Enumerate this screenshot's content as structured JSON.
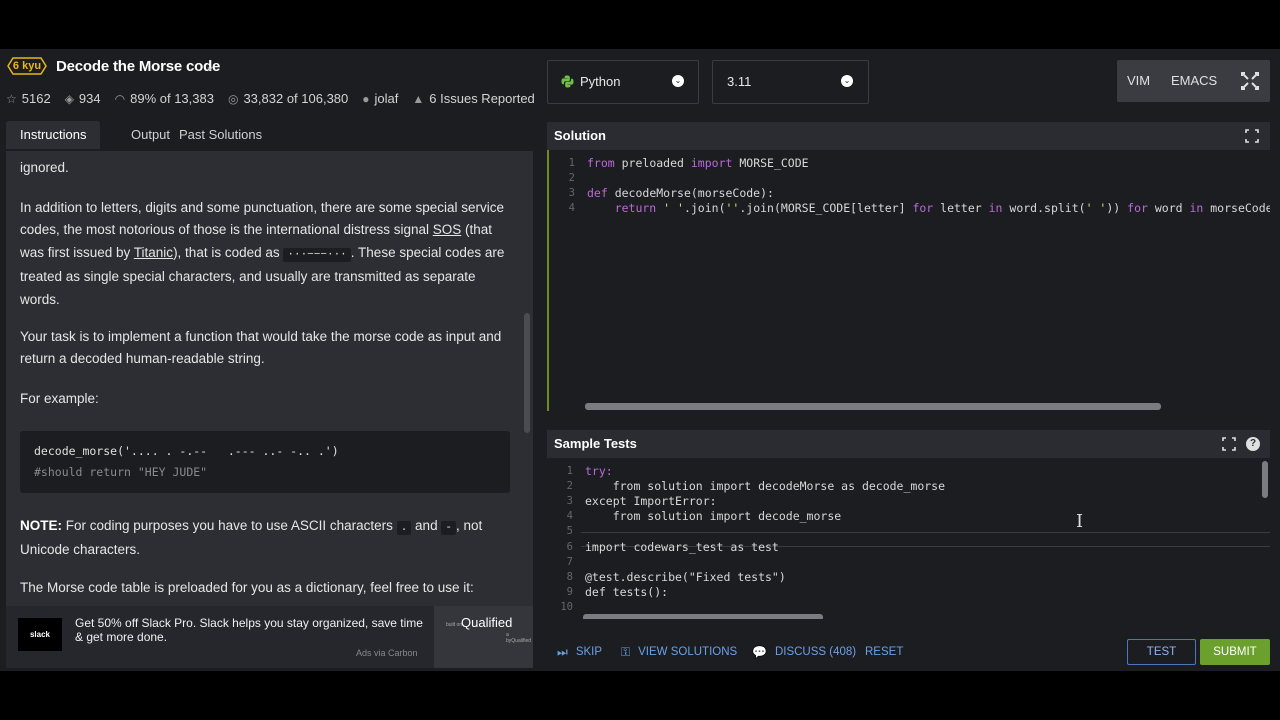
{
  "kata": {
    "rank": "6 kyu",
    "title": "Decode the Morse code",
    "title_chevron": "⌄",
    "stats": {
      "stars": "5162",
      "collections": "934",
      "satisfaction": "89% of 13,383",
      "completed": "33,832 of 106,380",
      "author": "jolaf",
      "issues": "6 Issues Reported"
    }
  },
  "left_tabs": [
    "Instructions",
    "Output",
    "Past Solutions"
  ],
  "instructions": {
    "p0": "ignored.",
    "p1_a": "In addition to letters, digits and some punctuation, there are some special service codes, the most notorious of those is the international distress signal ",
    "p1_link1": "SOS",
    "p1_b": " (that was first issued by ",
    "p1_link2": "Titanic",
    "p1_c": "), that is coded as ",
    "p1_code": "···−−−···",
    "p1_d": ". These special codes are treated as single special characters, and usually are transmitted as separate words.",
    "p2": "Your task is to implement a function that would take the morse code as input and return a decoded human-readable string.",
    "p3": "For example:",
    "code_line1": "decode_morse('.... . -.--   .--- ..- -.. .')",
    "code_line2": "#should return \"HEY JUDE\"",
    "p4_bold": "NOTE:",
    "p4_a": " For coding purposes you have to use ASCII characters ",
    "p4_code1": ".",
    "p4_b": " and ",
    "p4_code2": "-",
    "p4_c": ", not Unicode characters.",
    "p5": "The Morse code table is preloaded for you as a dictionary, feel free to use it:"
  },
  "ad": {
    "logo": "slack",
    "text": "Get 50% off Slack Pro. Slack helps you stay organized, save time & get more done.",
    "via": "Ads via Carbon",
    "sponsor": "Qualified",
    "sponsor_prefix": "built on",
    "sponsor_sub": "a byQualified"
  },
  "toolbar": {
    "language": "Python",
    "version": "3.11",
    "mode_vim": "VIM",
    "mode_emacs": "EMACS"
  },
  "solution": {
    "title": "Solution",
    "line_numbers": [
      "1",
      "2",
      "3",
      "4"
    ],
    "lines": [
      [
        "from",
        " preloaded ",
        "import",
        " MORSE_CODE"
      ],
      [],
      [
        "def",
        " decodeMorse(morseCode):"
      ],
      [
        "    return ",
        "' '",
        ".join(",
        "''",
        ".join(MORSE_CODE[letter] ",
        "for",
        " letter ",
        "in",
        " word.split(",
        "' '",
        ")) ",
        "for",
        " word ",
        "in",
        " morseCode.st"
      ]
    ]
  },
  "sample_tests": {
    "title": "Sample Tests",
    "help": "?",
    "line_numbers": [
      "1",
      "2",
      "3",
      "4",
      "5",
      "6",
      "7",
      "8",
      "9",
      "10"
    ],
    "lines": [
      "try:",
      "    from solution import decodeMorse as decode_morse",
      "except ImportError:",
      "    from solution import decode_morse",
      "",
      "import codewars_test as test",
      "",
      "@test.describe(\"Fixed tests\")",
      "def tests():",
      ""
    ]
  },
  "bottom_bar": {
    "skip": "SKIP",
    "view_solutions": "VIEW SOLUTIONS",
    "discuss": "DISCUSS (408)",
    "reset": "RESET",
    "test": "TEST",
    "submit": "SUBMIT"
  },
  "colors": {
    "rank": "#ecb613",
    "accent_blue": "#6ba0e8",
    "submit_green": "#6ba02c",
    "keyword": "#b96ad8",
    "string": "#c3e88d"
  }
}
